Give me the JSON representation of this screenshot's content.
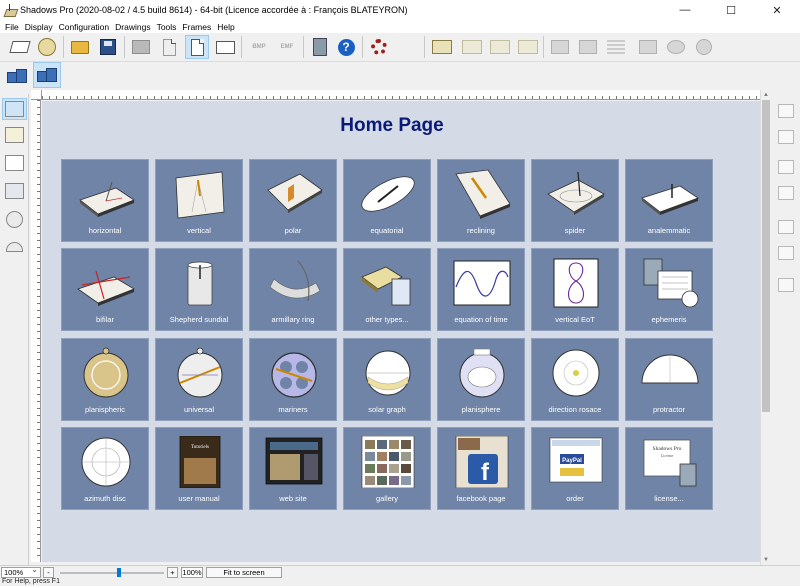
{
  "window": {
    "title": "Shadows Pro (2020-08-02 / 4.5 build 8614) - 64-bit  (Licence accordée à :  François BLATEYRON)",
    "minimize": "—",
    "maximize": "☐",
    "close": "✕"
  },
  "menu": [
    "File",
    "Display",
    "Configuration",
    "Drawings",
    "Tools",
    "Frames",
    "Help"
  ],
  "toolbar": {
    "export_label_1": "BMP",
    "export_label_2": "EMF",
    "help_glyph": "?"
  },
  "page": {
    "title": "Home Page",
    "tiles": [
      {
        "label": "horizontal",
        "icon": "horizontal-sundial-icon"
      },
      {
        "label": "vertical",
        "icon": "vertical-sundial-icon"
      },
      {
        "label": "polar",
        "icon": "polar-sundial-icon"
      },
      {
        "label": "equatorial",
        "icon": "equatorial-sundial-icon"
      },
      {
        "label": "reclining",
        "icon": "reclining-sundial-icon"
      },
      {
        "label": "spider",
        "icon": "spider-sundial-icon"
      },
      {
        "label": "analemmatic",
        "icon": "analemmatic-sundial-icon"
      },
      {
        "label": "bifilar",
        "icon": "bifilar-sundial-icon"
      },
      {
        "label": "Shepherd sundial",
        "icon": "shepherd-sundial-icon"
      },
      {
        "label": "armillary ring",
        "icon": "armillary-ring-icon"
      },
      {
        "label": "other types...",
        "icon": "other-types-icon"
      },
      {
        "label": "equation of time",
        "icon": "equation-of-time-icon"
      },
      {
        "label": "vertical EoT",
        "icon": "vertical-eot-icon"
      },
      {
        "label": "ephemeris",
        "icon": "ephemeris-icon"
      },
      {
        "label": "planispheric",
        "icon": "planispheric-astrolabe-icon"
      },
      {
        "label": "universal",
        "icon": "universal-astrolabe-icon"
      },
      {
        "label": "mariners",
        "icon": "mariners-astrolabe-icon"
      },
      {
        "label": "solar graph",
        "icon": "solar-graph-icon"
      },
      {
        "label": "planisphere",
        "icon": "planisphere-icon"
      },
      {
        "label": "direction rosace",
        "icon": "direction-rosace-icon"
      },
      {
        "label": "protractor",
        "icon": "protractor-icon"
      },
      {
        "label": "azimuth disc",
        "icon": "azimuth-disc-icon"
      },
      {
        "label": "user manual",
        "icon": "user-manual-icon"
      },
      {
        "label": "web site",
        "icon": "web-site-icon"
      },
      {
        "label": "gallery",
        "icon": "gallery-icon"
      },
      {
        "label": "facebook page",
        "icon": "facebook-icon"
      },
      {
        "label": "order",
        "icon": "order-icon"
      },
      {
        "label": "license...",
        "icon": "license-icon"
      }
    ]
  },
  "tile_art_text": {
    "manual_title": "Tutoriels",
    "license_title": "Shadows Pro",
    "license_sub": "License",
    "paypal": "PayPal",
    "facebook": "f"
  },
  "zoombar": {
    "zoom_value": "100%",
    "minus": "-",
    "plus": "+",
    "zoom_field": "100%",
    "fit_label": "Fit to screen"
  },
  "status": {
    "text": "For Help, press F1"
  },
  "colors": {
    "tile_bg": "#6f84a7",
    "page_bg": "#d5dbe6",
    "title_color": "#0a1a78"
  }
}
